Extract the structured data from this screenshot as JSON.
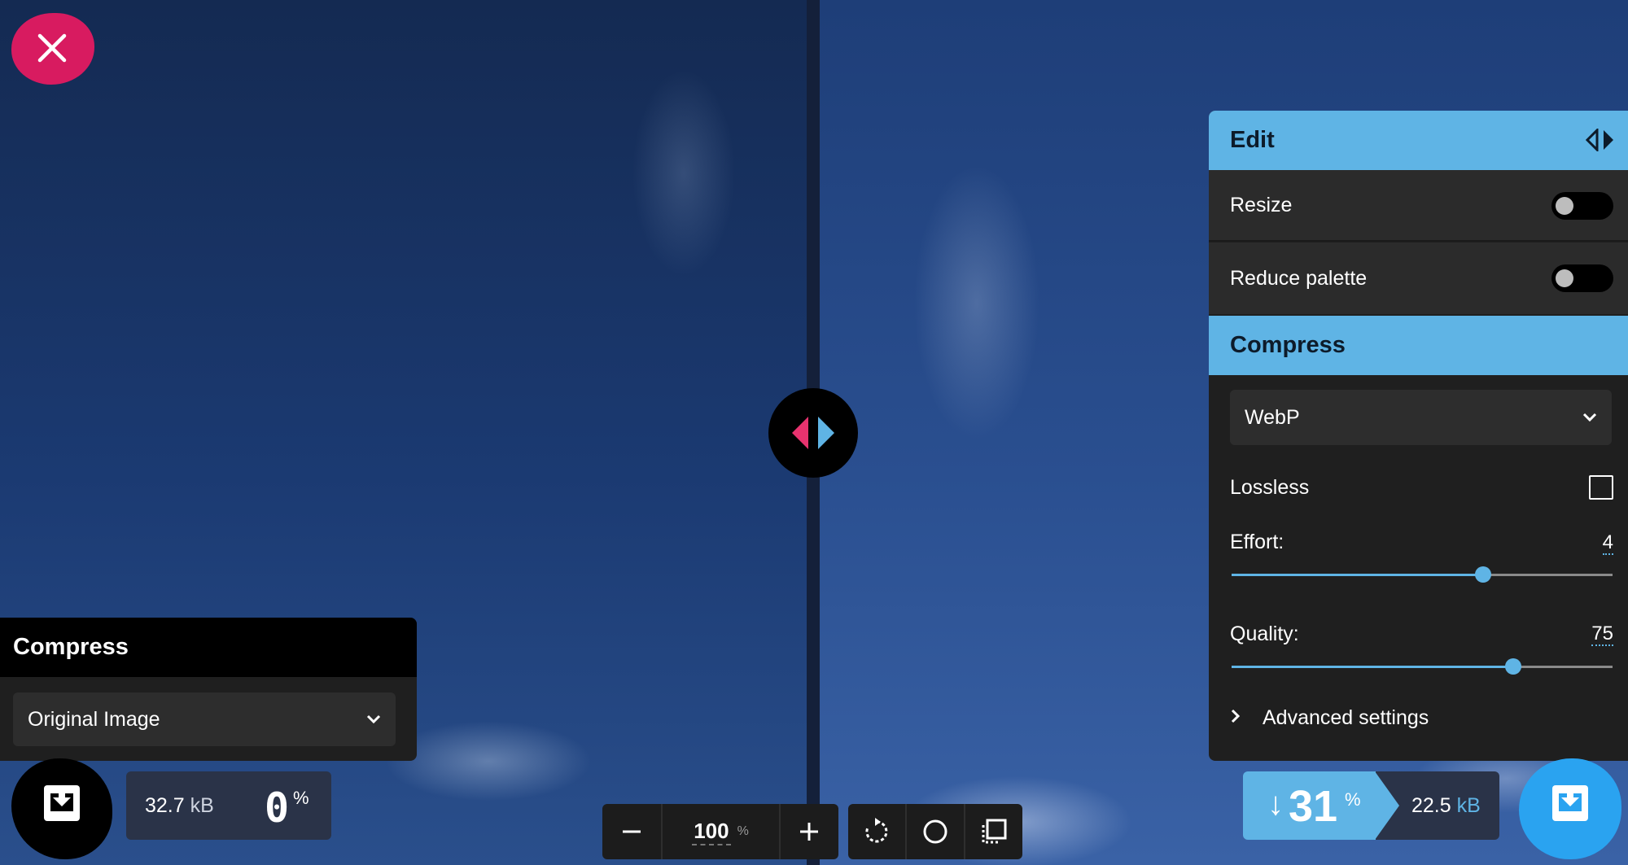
{
  "left_panel": {
    "title": "Compress",
    "method_select": "Original Image"
  },
  "left_stats": {
    "size_value": "32.7",
    "size_unit": "kB",
    "percent": "0",
    "percent_sign": "%"
  },
  "zoom": {
    "value": "100",
    "unit": "%"
  },
  "right_panel": {
    "edit_title": "Edit",
    "resize_label": "Resize",
    "resize_enabled": false,
    "reduce_palette_label": "Reduce palette",
    "reduce_palette_enabled": false,
    "compress_title": "Compress",
    "format_select": "WebP",
    "lossless_label": "Lossless",
    "lossless_checked": false,
    "effort_label": "Effort:",
    "effort_value": "4",
    "effort_fraction": 0.66,
    "quality_label": "Quality:",
    "quality_value": "75",
    "quality_fraction": 0.74,
    "advanced_label": "Advanced settings"
  },
  "right_stats": {
    "arrow": "↓",
    "savings": "31",
    "percent_sign": "%",
    "size_value": "22.5",
    "size_unit": "kB"
  },
  "colors": {
    "accent_blue": "#5fb4e5",
    "accent_pink": "#d81b60",
    "download_blue": "#2aa3f0"
  },
  "icons": {
    "close": "close-icon",
    "divider": "split-arrows-icon",
    "download": "download-icon",
    "rotate": "rotate-icon",
    "background": "circle-icon",
    "crop": "crop-icon",
    "chevron": "chevron-down-icon"
  }
}
